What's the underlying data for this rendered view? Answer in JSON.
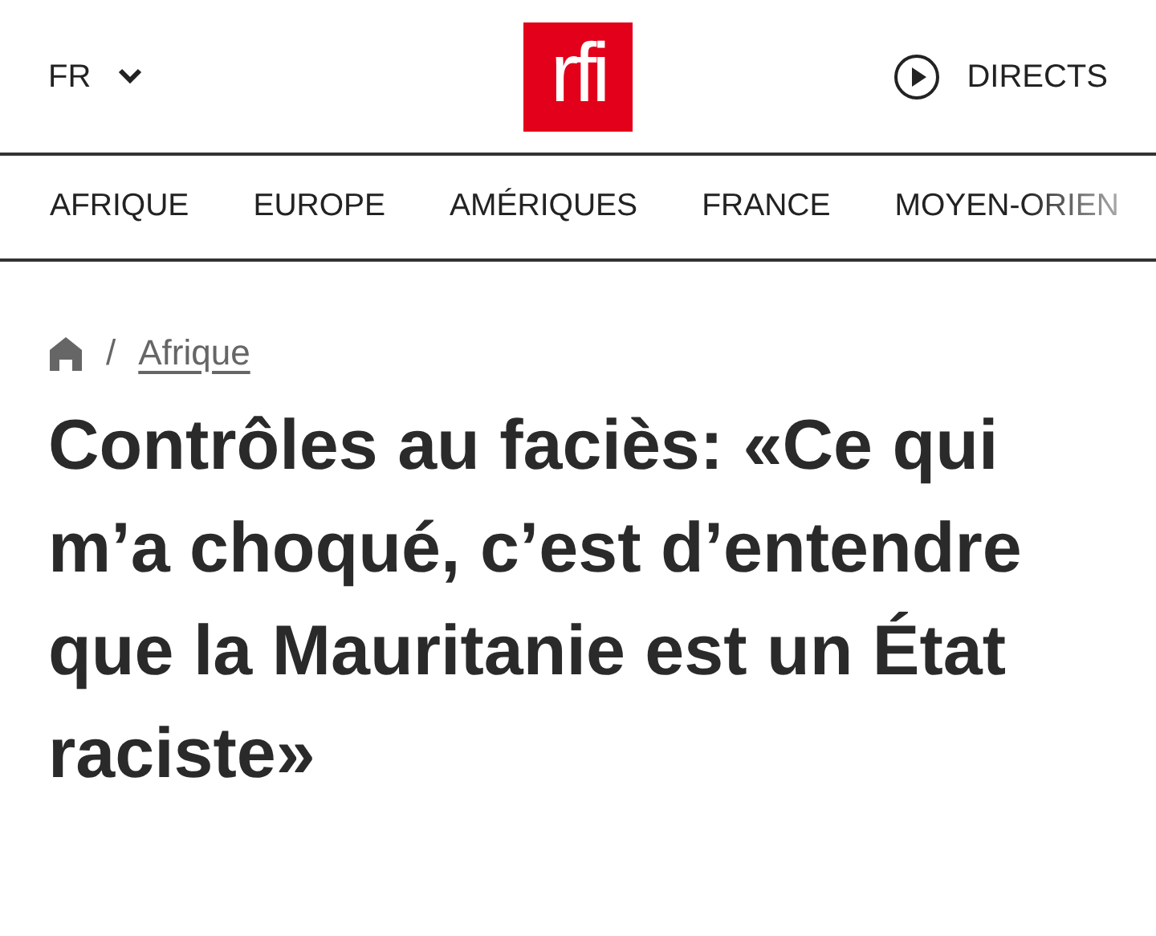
{
  "header": {
    "language": "FR",
    "logo": "rfi",
    "live_label": "DIRECTS"
  },
  "nav": [
    {
      "label": "AFRIQUE"
    },
    {
      "label": "EUROPE"
    },
    {
      "label": "AMÉRIQUES"
    },
    {
      "label": "FRANCE"
    },
    {
      "label": "MOYEN-ORIEN"
    }
  ],
  "breadcrumb": {
    "separator": "/",
    "section": "Afrique"
  },
  "headline": "Contrôles au faciès: «Ce qui m’a choqué, c’est d’entendre que la Mauritanie est un État raciste»"
}
